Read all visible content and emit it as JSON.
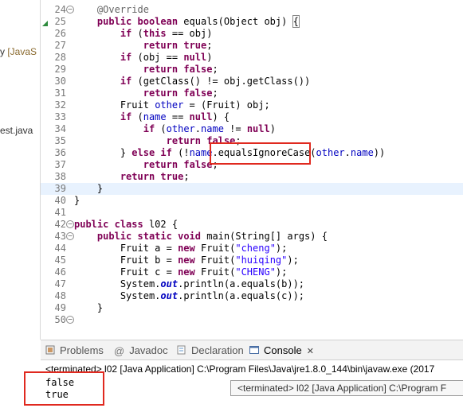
{
  "left_panel": {
    "frag1_text": "y ",
    "frag1_annot": "[JavaS",
    "frag2_text": "est.java"
  },
  "editor": {
    "lines": [
      {
        "num": "24",
        "marker": "fold",
        "marker_glyph": "−"
      },
      {
        "num": "25",
        "marker": "override-arrow"
      },
      {
        "num": "26"
      },
      {
        "num": "27"
      },
      {
        "num": "28"
      },
      {
        "num": "29"
      },
      {
        "num": "30"
      },
      {
        "num": "31"
      },
      {
        "num": "32"
      },
      {
        "num": "33"
      },
      {
        "num": "34"
      },
      {
        "num": "35"
      },
      {
        "num": "36"
      },
      {
        "num": "37"
      },
      {
        "num": "38"
      },
      {
        "num": "39",
        "current": true
      },
      {
        "num": "40"
      },
      {
        "num": "41"
      },
      {
        "num": "42",
        "marker": "fold",
        "marker_glyph": "−"
      },
      {
        "num": "43",
        "marker": "fold",
        "marker_glyph": "−"
      },
      {
        "num": "44"
      },
      {
        "num": "45"
      },
      {
        "num": "46"
      },
      {
        "num": "47"
      },
      {
        "num": "48"
      },
      {
        "num": "49"
      },
      {
        "num": "50",
        "marker": "fold",
        "marker_glyph": "−"
      }
    ],
    "code": {
      "l24": {
        "annotation": "@Override"
      },
      "l25": {
        "kw1": "public",
        "kw2": "boolean",
        "rest": " equals(Object obj) ",
        "brace": "{"
      },
      "l26": {
        "kw": "if",
        "rest": " (",
        "kw_this": "this",
        "rest2": " == obj)"
      },
      "l27": {
        "kw": "return",
        "kw_val": "true",
        "end": ";"
      },
      "l28": {
        "kw": "if",
        "rest": " (obj == ",
        "kw_null": "null",
        "end": ")"
      },
      "l29": {
        "kw": "return",
        "kw_val": "false",
        "end": ";"
      },
      "l30": {
        "kw": "if",
        "rest": " (getClass() != obj.getClass())"
      },
      "l31": {
        "kw": "return",
        "kw_val": "false",
        "end": ";"
      },
      "l32": {
        "pre": "Fruit ",
        "fld": "other",
        "rest": " = (Fruit) obj;"
      },
      "l33": {
        "kw": "if",
        "pre": " (",
        "fld": "name",
        "mid": " == ",
        "kw_null": "null",
        "end": ") {"
      },
      "l34": {
        "kw": "if",
        "pre": " (",
        "fld_a": "other",
        "dot": ".",
        "fld_b": "name",
        "mid": " != ",
        "kw_null": "null",
        "end": ")"
      },
      "l35": {
        "kw": "return",
        "kw_val": "false",
        "end": ";"
      },
      "l36": {
        "pre": "} ",
        "kw1": "else",
        "sp": " ",
        "kw2": "if",
        "mid": " (!",
        "fld": "name",
        "dot": ".",
        "call": "equalsIgnoreCase(",
        "fld_a": "other",
        "dot2": ".",
        "fld_b": "name",
        "end": "))"
      },
      "l37": {
        "kw": "return",
        "kw_val": "false",
        "end": ";"
      },
      "l38": {
        "kw": "return",
        "kw_val": "true",
        "end": ";"
      },
      "l39": {
        "text": "}"
      },
      "l40": {
        "text": "}"
      },
      "l41": {
        "text": ""
      },
      "l42": {
        "kw1": "public",
        "kw2": "class",
        "rest": " l02 {"
      },
      "l43": {
        "kw1": "public",
        "kw2": "static",
        "kw3": "void",
        "rest": " main(String[] args) {"
      },
      "l44": {
        "pre": "Fruit a = ",
        "kw": "new",
        "mid": " Fruit(",
        "str": "\"cheng\"",
        "end": ");"
      },
      "l45": {
        "pre": "Fruit b = ",
        "kw": "new",
        "mid": " Fruit(",
        "str": "\"huiqing\"",
        "end": ");"
      },
      "l46": {
        "pre": "Fruit c = ",
        "kw": "new",
        "mid": " Fruit(",
        "str": "\"CHENG\"",
        "end": ");"
      },
      "l47": {
        "pre": "System.",
        "st": "out",
        "rest": ".println(a.equals(b));"
      },
      "l48": {
        "pre": "System.",
        "st": "out",
        "rest": ".println(a.equals(c));"
      },
      "l49": {
        "text": "}"
      }
    }
  },
  "views_bar": {
    "tabs": [
      {
        "label": "Problems",
        "icon": "problems-icon"
      },
      {
        "label": "Javadoc",
        "icon": "at-icon",
        "glyph": "@"
      },
      {
        "label": "Declaration",
        "icon": "declaration-icon"
      },
      {
        "label": "Console",
        "icon": "console-icon",
        "active": true,
        "close": "✕"
      }
    ]
  },
  "console": {
    "status": "<terminated> l02 [Java Application] C:\\Program Files\\Java\\jre1.8.0_144\\bin\\javaw.exe (2017",
    "output": [
      "false",
      "true"
    ],
    "tooltip": "<terminated> l02 [Java Application] C:\\Program F"
  },
  "colors": {
    "keyword": "#7f0055",
    "field": "#0000c0",
    "string": "#2a00ff",
    "annotation": "#646464",
    "highlight_box": "#e0291f",
    "current_line": "#e8f2fe"
  }
}
